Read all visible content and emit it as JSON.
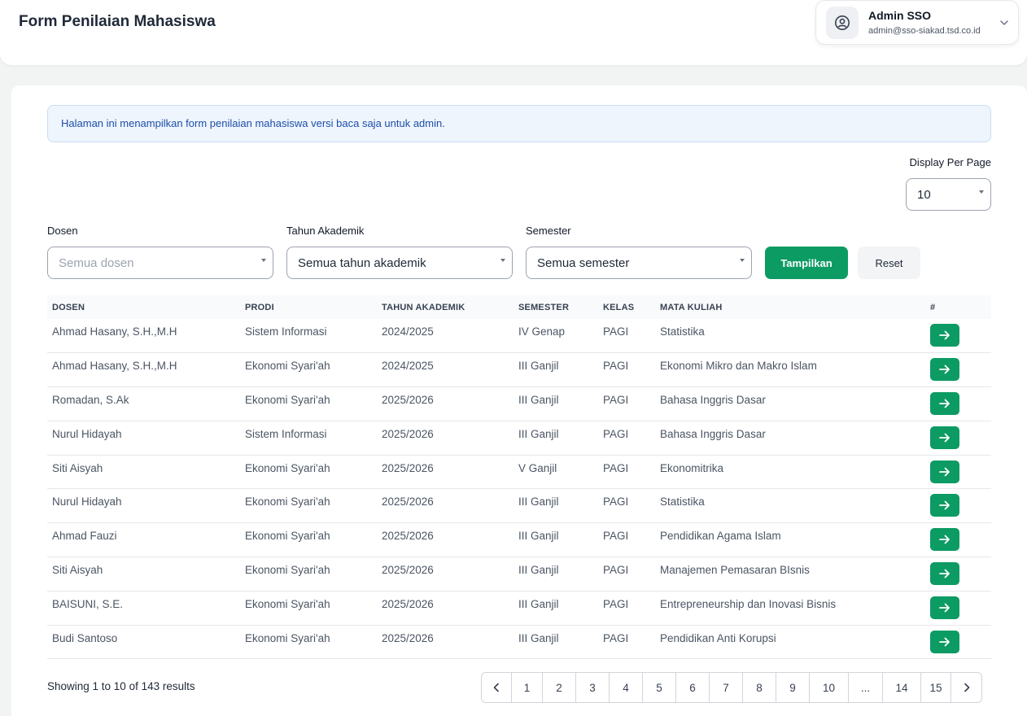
{
  "header": {
    "title": "Form Penilaian Mahasiswa",
    "user": {
      "name": "Admin SSO",
      "email": "admin@sso-siakad.tsd.co.id"
    }
  },
  "alert": {
    "text": "Halaman ini menampilkan form penilaian mahasiswa versi baca saja untuk admin."
  },
  "per_page": {
    "label": "Display Per Page",
    "value": "10"
  },
  "filters": {
    "dosen": {
      "label": "Dosen",
      "placeholder": "Semua dosen"
    },
    "tahun": {
      "label": "Tahun Akademik",
      "value": "Semua tahun akademik"
    },
    "semester": {
      "label": "Semester",
      "value": "Semua semester"
    },
    "show_label": "Tampilkan",
    "reset_label": "Reset"
  },
  "table": {
    "headers": [
      "DOSEN",
      "PRODI",
      "TAHUN AKADEMIK",
      "SEMESTER",
      "KELAS",
      "MATA KULIAH",
      "#"
    ],
    "rows": [
      [
        "Ahmad Hasany, S.H.,M.H",
        "Sistem Informasi",
        "2024/2025",
        "IV Genap",
        "PAGI",
        "Statistika"
      ],
      [
        "Ahmad Hasany, S.H.,M.H",
        "Ekonomi Syari'ah",
        "2024/2025",
        "III Ganjil",
        "PAGI",
        "Ekonomi Mikro dan Makro Islam"
      ],
      [
        "Romadan, S.Ak",
        "Ekonomi Syari'ah",
        "2025/2026",
        "III Ganjil",
        "PAGI",
        "Bahasa Inggris Dasar"
      ],
      [
        "Nurul Hidayah",
        "Sistem Informasi",
        "2025/2026",
        "III Ganjil",
        "PAGI",
        "Bahasa Inggris Dasar"
      ],
      [
        "Siti Aisyah",
        "Ekonomi Syari'ah",
        "2025/2026",
        "V Ganjil",
        "PAGI",
        "Ekonomitrika"
      ],
      [
        "Nurul Hidayah",
        "Ekonomi Syari'ah",
        "2025/2026",
        "III Ganjil",
        "PAGI",
        "Statistika"
      ],
      [
        "Ahmad Fauzi",
        "Ekonomi Syari'ah",
        "2025/2026",
        "III Ganjil",
        "PAGI",
        "Pendidikan Agama Islam"
      ],
      [
        "Siti Aisyah",
        "Ekonomi Syari'ah",
        "2025/2026",
        "III Ganjil",
        "PAGI",
        "Manajemen Pemasaran BIsnis"
      ],
      [
        "BAISUNI, S.E.",
        "Ekonomi Syari'ah",
        "2025/2026",
        "III Ganjil",
        "PAGI",
        "Entrepreneurship dan Inovasi Bisnis"
      ],
      [
        "Budi Santoso",
        "Ekonomi Syari'ah",
        "2025/2026",
        "III Ganjil",
        "PAGI",
        "Pendidikan Anti Korupsi"
      ]
    ]
  },
  "footer": {
    "results_text": "Showing 1 to 10 of 143 results",
    "pages": [
      "1",
      "2",
      "3",
      "4",
      "5",
      "6",
      "7",
      "8",
      "9",
      "10",
      "...",
      "14",
      "15"
    ]
  },
  "colors": {
    "accent": "#0c9b63",
    "alert_bg": "#eef5fd",
    "alert_text": "#1e4ea8"
  }
}
